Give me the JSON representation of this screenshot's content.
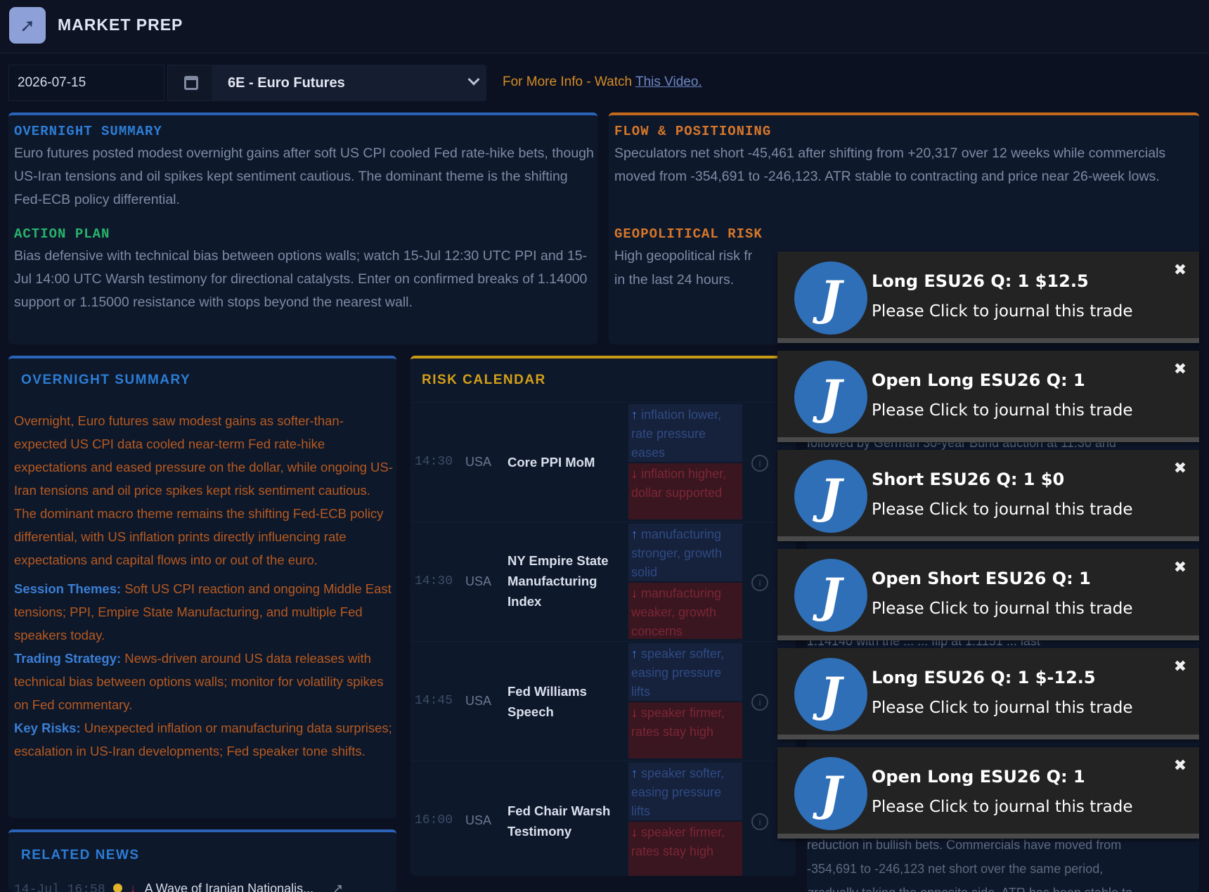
{
  "header": {
    "logo_icon": "chart-trend-icon",
    "title": "MARKET PREP"
  },
  "controls": {
    "date_value": "2026-07-15",
    "calendar_icon": "calendar-icon",
    "instrument": "6E - Euro Futures",
    "more_info_prefix": "For More Info - Watch ",
    "more_info_link": "This Video."
  },
  "summary_top": {
    "overnight_heading": "OVERNIGHT SUMMARY",
    "overnight_text": "Euro futures posted modest overnight gains after soft US CPI cooled Fed rate-hike bets, though US-Iran tensions and oil spikes kept sentiment cautious. The dominant theme is the shifting Fed-ECB policy differential.",
    "action_heading": "ACTION PLAN",
    "action_text": "Bias defensive with technical bias between options walls; watch 15-Jul 12:30 UTC PPI and 15-Jul 14:00 UTC Warsh testimony for directional catalysts. Enter on confirmed breaks of 1.14000 support or 1.15000 resistance with stops beyond the nearest wall."
  },
  "flow": {
    "heading": "FLOW & POSITIONING",
    "text": "Speculators net short -45,461 after shifting from +20,317 over 12 weeks while commercials moved from -354,691 to -246,123. ATR stable to contracting and price near 26-week lows.",
    "geo_heading": "GEOPOLITICAL RISK",
    "geo_text": "High geopolitical risk fr",
    "geo_text2": "in the last 24 hours."
  },
  "overnight_detail": {
    "heading": "OVERNIGHT SUMMARY",
    "text": "Overnight, Euro futures saw modest gains as softer-than-expected US CPI data cooled near-term Fed rate-hike expectations and eased pressure on the dollar, while ongoing US-Iran tensions and oil price spikes kept risk sentiment cautious. The dominant macro theme remains the shifting Fed-ECB policy differential, with US inflation prints directly influencing rate expectations and capital flows into or out of the euro.",
    "themes_label": "Session Themes:",
    "themes_text": " Soft US CPI reaction and ongoing Middle East tensions; PPI, Empire State Manufacturing, and multiple Fed speakers today.",
    "strategy_label": "Trading Strategy:",
    "strategy_text": " News-driven around US data releases with technical bias between options walls; monitor for volatility spikes on Fed commentary.",
    "risks_label": "Key Risks:",
    "risks_text": " Unexpected inflation or manufacturing data surprises; escalation in US-Iran developments; Fed speaker tone shifts."
  },
  "risk_calendar": {
    "heading": "RISK CALENDAR",
    "rows": [
      {
        "time": "14:30",
        "country": "USA",
        "event": "Core PPI MoM",
        "up_arrow": "↑",
        "up": " inflation lower, rate pressure eases",
        "down_arrow": "↓",
        "down": " inflation higher, dollar supported"
      },
      {
        "time": "14:30",
        "country": "USA",
        "event": "NY Empire State Manufacturing Index",
        "up_arrow": "↑",
        "up": " manufacturing stronger, growth solid",
        "down_arrow": "↓",
        "down": " manufacturing weaker, growth concerns"
      },
      {
        "time": "14:45",
        "country": "USA",
        "event": "Fed Williams Speech",
        "up_arrow": "↑",
        "up": " speaker softer, easing pressure lifts",
        "down_arrow": "↓",
        "down": " speaker firmer, rates stay high"
      },
      {
        "time": "16:00",
        "country": "USA",
        "event": "Fed Chair Warsh Testimony",
        "up_arrow": "↑",
        "up": " speaker softer, easing pressure lifts",
        "down_arrow": "↓",
        "down": " speaker firmer, rates stay high"
      }
    ]
  },
  "news": {
    "heading": "RELATED NEWS",
    "items": [
      {
        "time": "14-Jul 16:58",
        "arrow": "↓",
        "title": "A Wave of Iranian Nationalis..."
      }
    ]
  },
  "peeking_text": {
    "line1": "followed by German 30-year Bund auction at 11:30 and",
    "line2": "1.14140 with the ...   ... flip at 1.1151 ... last",
    "line3": "reduction in bullish bets. Commercials have moved from",
    "line4": "-354,691 to -246,123 net short over the same period,",
    "line5": "gradually taking the opposite side. ATR has been stable to"
  },
  "toasts": [
    {
      "title": "Long ESU26 Q: 1 $12.5",
      "message": "Please Click to journal this trade",
      "avatar": "J"
    },
    {
      "title": "Open Long ESU26 Q: 1",
      "message": "Please Click to journal this trade",
      "avatar": "J"
    },
    {
      "title": "Short ESU26 Q: 1 $0",
      "message": "Please Click to journal this trade",
      "avatar": "J"
    },
    {
      "title": "Open Short ESU26 Q: 1",
      "message": "Please Click to journal this trade",
      "avatar": "J"
    },
    {
      "title": "Long ESU26 Q: 1 $-12.5",
      "message": "Please Click to journal this trade",
      "avatar": "J"
    },
    {
      "title": "Open Long ESU26 Q: 1",
      "message": "Please Click to journal this trade",
      "avatar": "J"
    }
  ],
  "colors": {
    "accent_blue": "#2c7dd6",
    "accent_orange": "#d7772a",
    "accent_yellow": "#d4a017",
    "toast_bg": "#232323",
    "avatar_bg": "#2e6fb8"
  }
}
